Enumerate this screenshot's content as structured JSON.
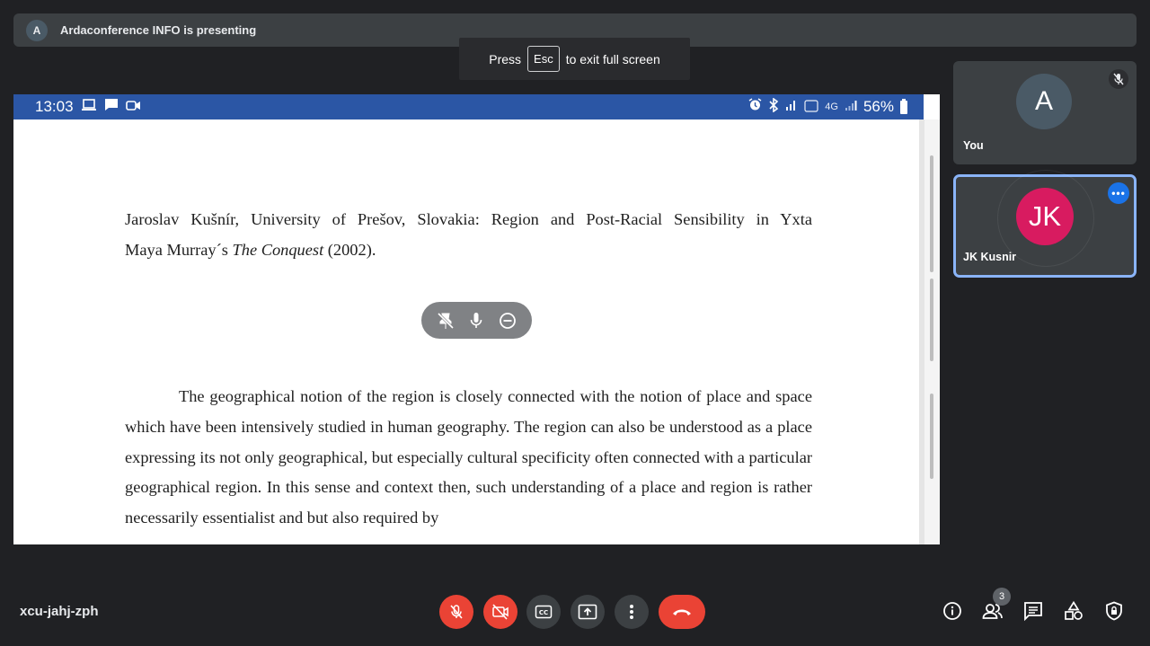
{
  "banner": {
    "avatar_letter": "A",
    "text": "Ardaconference INFO is presenting"
  },
  "fullscreen_toast": {
    "press": "Press",
    "key": "Esc",
    "suffix": "to exit full screen"
  },
  "shared_screen": {
    "status_bar": {
      "time": "13:03",
      "network_text": "4G",
      "battery_percent": "56%"
    },
    "document": {
      "title_line1": "Jaroslav Kušnír, University of Prešov, Slovakia: Region and Post-Racial Sensibility in Yxta",
      "title_line2_prefix": "Maya Murray´s",
      "title_line2_italic": "The Conquest",
      "title_line2_suffix": "(2002).",
      "body": "The geographical notion of the region is closely connected with the notion of place and space which have been intensively studied in human geography. The region can also be understood as a place expressing its not only geographical, but especially cultural specificity often connected with a particular geographical region. In this sense and context then, such understanding of a place and region is rather necessarily essentialist and but also required by"
    },
    "floating_controls": [
      "unpin-icon",
      "mic-icon",
      "remove-icon"
    ]
  },
  "participants": [
    {
      "name": "You",
      "initials": "A",
      "color": "#4a5a66",
      "muted": true
    },
    {
      "name": "JK Kusnir",
      "initials": "JK",
      "color": "#d81b60",
      "speaking": true
    }
  ],
  "bottom_bar": {
    "meeting_code": "xcu-jahj-zph",
    "people_count": "3",
    "controls": [
      "mic-off",
      "camera-off",
      "captions",
      "present",
      "more",
      "leave-call"
    ],
    "right_controls": [
      "meeting-details",
      "people",
      "chat",
      "activities",
      "host-controls"
    ]
  },
  "colors": {
    "accent": "#8ab4f8",
    "danger": "#ea4335",
    "status_bar": "#2b56a5"
  }
}
